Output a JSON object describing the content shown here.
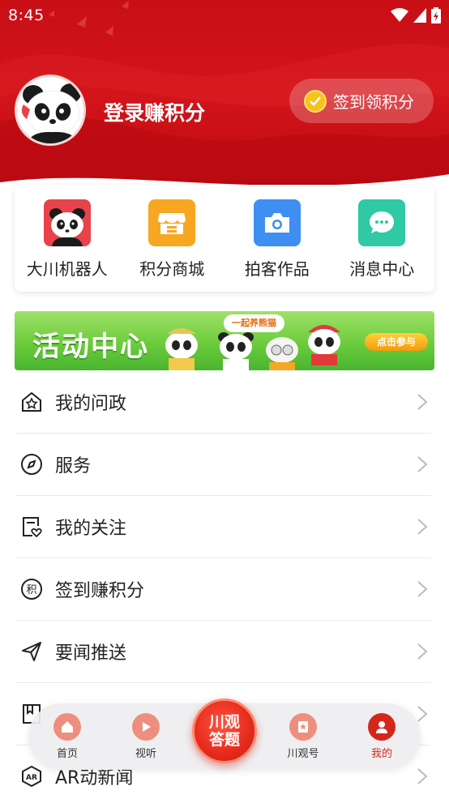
{
  "status_bar": {
    "time": "8:45"
  },
  "profile": {
    "login_text": "登录赚积分",
    "checkin_label": "签到领积分"
  },
  "quick_actions": [
    {
      "label": "大川机器人",
      "icon": "panda-robot-icon",
      "color": "#e8434a"
    },
    {
      "label": "积分商城",
      "icon": "shop-icon",
      "color": "#f7a722"
    },
    {
      "label": "拍客作品",
      "icon": "camera-icon",
      "color": "#3f8ef2"
    },
    {
      "label": "消息中心",
      "icon": "chat-icon",
      "color": "#2fc9a4"
    }
  ],
  "banner": {
    "title": "活动中心",
    "bubble": "一起养熊猫",
    "join_label": "点击参与"
  },
  "menu": [
    {
      "label": "我的问政",
      "icon": "home-star-icon"
    },
    {
      "label": "服务",
      "icon": "compass-icon"
    },
    {
      "label": "我的关注",
      "icon": "follow-heart-icon"
    },
    {
      "label": "签到赚积分",
      "icon": "points-icon"
    },
    {
      "label": "要闻推送",
      "icon": "send-icon"
    },
    {
      "label": "",
      "icon": "bookmark-icon"
    },
    {
      "label": "AR动新闻",
      "icon": "ar-icon"
    }
  ],
  "tabbar": {
    "items": [
      {
        "label": "首页",
        "icon": "home-icon"
      },
      {
        "label": "视听",
        "icon": "play-icon"
      },
      {
        "label": "川观号",
        "icon": "badge-icon"
      },
      {
        "label": "我的",
        "icon": "user-icon",
        "active": true
      }
    ],
    "center_line1": "川观",
    "center_line2": "答题"
  },
  "colors": {
    "brand_red": "#c90f16",
    "active_red": "#d5261c"
  }
}
